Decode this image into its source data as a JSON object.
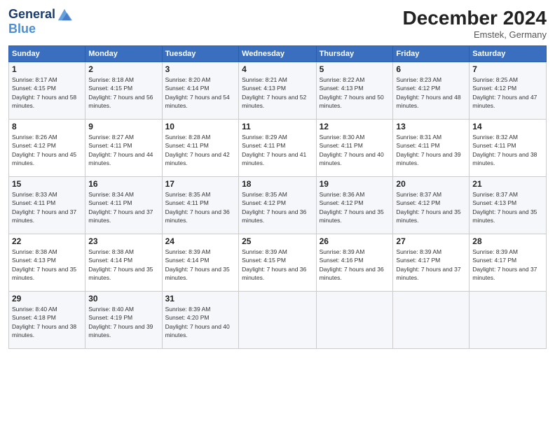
{
  "logo": {
    "line1": "General",
    "line2": "Blue"
  },
  "title": "December 2024",
  "location": "Emstek, Germany",
  "weekdays": [
    "Sunday",
    "Monday",
    "Tuesday",
    "Wednesday",
    "Thursday",
    "Friday",
    "Saturday"
  ],
  "weeks": [
    [
      {
        "day": "1",
        "sunrise": "8:17 AM",
        "sunset": "4:15 PM",
        "daylight": "7 hours and 58 minutes."
      },
      {
        "day": "2",
        "sunrise": "8:18 AM",
        "sunset": "4:15 PM",
        "daylight": "7 hours and 56 minutes."
      },
      {
        "day": "3",
        "sunrise": "8:20 AM",
        "sunset": "4:14 PM",
        "daylight": "7 hours and 54 minutes."
      },
      {
        "day": "4",
        "sunrise": "8:21 AM",
        "sunset": "4:13 PM",
        "daylight": "7 hours and 52 minutes."
      },
      {
        "day": "5",
        "sunrise": "8:22 AM",
        "sunset": "4:13 PM",
        "daylight": "7 hours and 50 minutes."
      },
      {
        "day": "6",
        "sunrise": "8:23 AM",
        "sunset": "4:12 PM",
        "daylight": "7 hours and 48 minutes."
      },
      {
        "day": "7",
        "sunrise": "8:25 AM",
        "sunset": "4:12 PM",
        "daylight": "7 hours and 47 minutes."
      }
    ],
    [
      {
        "day": "8",
        "sunrise": "8:26 AM",
        "sunset": "4:12 PM",
        "daylight": "7 hours and 45 minutes."
      },
      {
        "day": "9",
        "sunrise": "8:27 AM",
        "sunset": "4:11 PM",
        "daylight": "7 hours and 44 minutes."
      },
      {
        "day": "10",
        "sunrise": "8:28 AM",
        "sunset": "4:11 PM",
        "daylight": "7 hours and 42 minutes."
      },
      {
        "day": "11",
        "sunrise": "8:29 AM",
        "sunset": "4:11 PM",
        "daylight": "7 hours and 41 minutes."
      },
      {
        "day": "12",
        "sunrise": "8:30 AM",
        "sunset": "4:11 PM",
        "daylight": "7 hours and 40 minutes."
      },
      {
        "day": "13",
        "sunrise": "8:31 AM",
        "sunset": "4:11 PM",
        "daylight": "7 hours and 39 minutes."
      },
      {
        "day": "14",
        "sunrise": "8:32 AM",
        "sunset": "4:11 PM",
        "daylight": "7 hours and 38 minutes."
      }
    ],
    [
      {
        "day": "15",
        "sunrise": "8:33 AM",
        "sunset": "4:11 PM",
        "daylight": "7 hours and 37 minutes."
      },
      {
        "day": "16",
        "sunrise": "8:34 AM",
        "sunset": "4:11 PM",
        "daylight": "7 hours and 37 minutes."
      },
      {
        "day": "17",
        "sunrise": "8:35 AM",
        "sunset": "4:11 PM",
        "daylight": "7 hours and 36 minutes."
      },
      {
        "day": "18",
        "sunrise": "8:35 AM",
        "sunset": "4:12 PM",
        "daylight": "7 hours and 36 minutes."
      },
      {
        "day": "19",
        "sunrise": "8:36 AM",
        "sunset": "4:12 PM",
        "daylight": "7 hours and 35 minutes."
      },
      {
        "day": "20",
        "sunrise": "8:37 AM",
        "sunset": "4:12 PM",
        "daylight": "7 hours and 35 minutes."
      },
      {
        "day": "21",
        "sunrise": "8:37 AM",
        "sunset": "4:13 PM",
        "daylight": "7 hours and 35 minutes."
      }
    ],
    [
      {
        "day": "22",
        "sunrise": "8:38 AM",
        "sunset": "4:13 PM",
        "daylight": "7 hours and 35 minutes."
      },
      {
        "day": "23",
        "sunrise": "8:38 AM",
        "sunset": "4:14 PM",
        "daylight": "7 hours and 35 minutes."
      },
      {
        "day": "24",
        "sunrise": "8:39 AM",
        "sunset": "4:14 PM",
        "daylight": "7 hours and 35 minutes."
      },
      {
        "day": "25",
        "sunrise": "8:39 AM",
        "sunset": "4:15 PM",
        "daylight": "7 hours and 36 minutes."
      },
      {
        "day": "26",
        "sunrise": "8:39 AM",
        "sunset": "4:16 PM",
        "daylight": "7 hours and 36 minutes."
      },
      {
        "day": "27",
        "sunrise": "8:39 AM",
        "sunset": "4:17 PM",
        "daylight": "7 hours and 37 minutes."
      },
      {
        "day": "28",
        "sunrise": "8:39 AM",
        "sunset": "4:17 PM",
        "daylight": "7 hours and 37 minutes."
      }
    ],
    [
      {
        "day": "29",
        "sunrise": "8:40 AM",
        "sunset": "4:18 PM",
        "daylight": "7 hours and 38 minutes."
      },
      {
        "day": "30",
        "sunrise": "8:40 AM",
        "sunset": "4:19 PM",
        "daylight": "7 hours and 39 minutes."
      },
      {
        "day": "31",
        "sunrise": "8:39 AM",
        "sunset": "4:20 PM",
        "daylight": "7 hours and 40 minutes."
      },
      null,
      null,
      null,
      null
    ]
  ]
}
